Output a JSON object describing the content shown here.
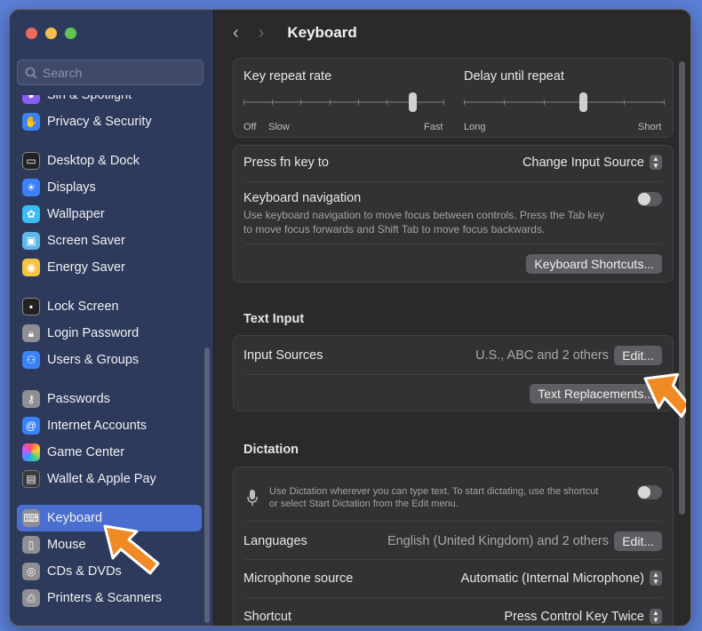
{
  "search": {
    "placeholder": "Search"
  },
  "sidebar": {
    "items": [
      {
        "label": "Siri & Spotlight",
        "icon": "siri-icon",
        "color": "#8a5cf0"
      },
      {
        "label": "Privacy & Security",
        "icon": "hand-icon",
        "color": "#3b82f6"
      },
      {
        "label": "Desktop & Dock",
        "icon": "dock-icon",
        "color": "#222222"
      },
      {
        "label": "Displays",
        "icon": "sun-icon",
        "color": "#3b82f6"
      },
      {
        "label": "Wallpaper",
        "icon": "flower-icon",
        "color": "#38bdf8"
      },
      {
        "label": "Screen Saver",
        "icon": "screen-icon",
        "color": "#5eb9e8"
      },
      {
        "label": "Energy Saver",
        "icon": "bulb-icon",
        "color": "#f5c542"
      },
      {
        "label": "Lock Screen",
        "icon": "lock-icon",
        "color": "#222222"
      },
      {
        "label": "Login Password",
        "icon": "padlock-icon",
        "color": "#8e8e93"
      },
      {
        "label": "Users & Groups",
        "icon": "users-icon",
        "color": "#3b82f6"
      },
      {
        "label": "Passwords",
        "icon": "key-icon",
        "color": "#8e8e93"
      },
      {
        "label": "Internet Accounts",
        "icon": "at-icon",
        "color": "#3b82f6"
      },
      {
        "label": "Game Center",
        "icon": "gamecenter-icon",
        "color": "#e8e8e8"
      },
      {
        "label": "Wallet & Apple Pay",
        "icon": "wallet-icon",
        "color": "#3a3a3a"
      },
      {
        "label": "Keyboard",
        "icon": "keyboard-icon",
        "color": "#8e8e93"
      },
      {
        "label": "Mouse",
        "icon": "mouse-icon",
        "color": "#8e8e93"
      },
      {
        "label": "CDs & DVDs",
        "icon": "disc-icon",
        "color": "#8e8e93"
      },
      {
        "label": "Printers & Scanners",
        "icon": "printer-icon",
        "color": "#8e8e93"
      }
    ]
  },
  "header": {
    "title": "Keyboard"
  },
  "repeat": {
    "rate_label": "Key repeat rate",
    "delay_label": "Delay until repeat",
    "rate_left": "Off",
    "rate_mid": "Slow",
    "rate_right": "Fast",
    "delay_left": "Long",
    "delay_right": "Short"
  },
  "fn": {
    "label": "Press fn key to",
    "value": "Change Input Source"
  },
  "nav": {
    "label": "Keyboard navigation",
    "desc1": "Use keyboard navigation to move focus between controls. Press the Tab key",
    "desc2": "to move focus forwards and Shift Tab to move focus backwards."
  },
  "shortcuts_button": "Keyboard Shortcuts...",
  "text_input": {
    "heading": "Text Input",
    "sources_label": "Input Sources",
    "sources_value": "U.S., ABC and 2 others",
    "edit": "Edit...",
    "replacements": "Text Replacements..."
  },
  "dictation": {
    "heading": "Dictation",
    "desc1": "Use Dictation wherever you can type text. To start dictating, use the shortcut",
    "desc2": "or select Start Dictation from the Edit menu.",
    "languages_label": "Languages",
    "languages_value": "English (United Kingdom) and 2 others",
    "edit": "Edit...",
    "mic_label": "Microphone source",
    "mic_value": "Automatic (Internal Microphone)",
    "shortcut_label": "Shortcut",
    "shortcut_value": "Press Control Key Twice"
  },
  "accent": "#f08a24"
}
